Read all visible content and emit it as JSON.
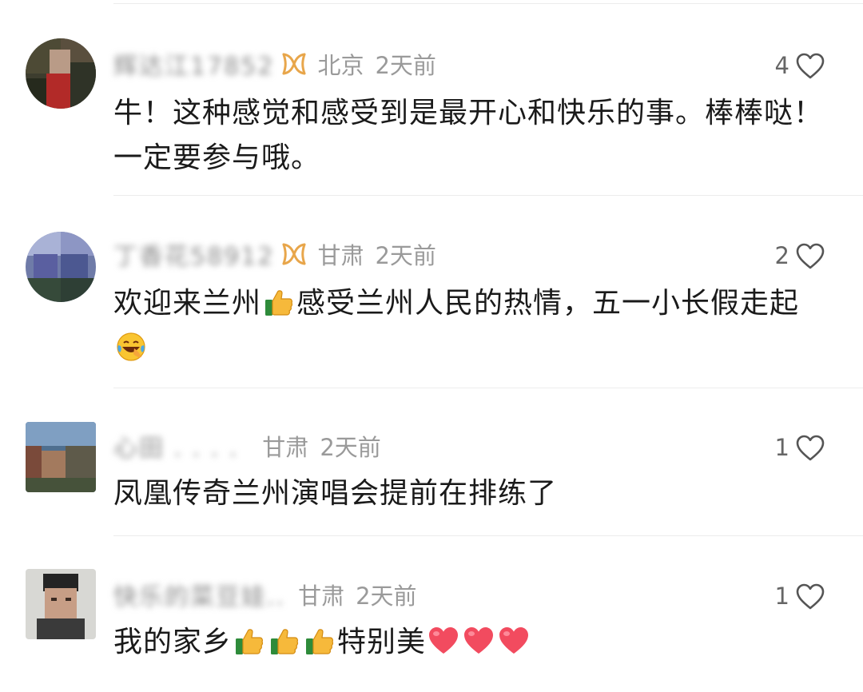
{
  "comments": [
    {
      "username": "辉达江17852",
      "has_vip_badge": true,
      "location": "北京",
      "time": "2天前",
      "likes": "4",
      "content": "牛！这种感觉和感受到是最开心和快乐的事。棒棒哒！一定要参与哦。"
    },
    {
      "username": "丁香花58912",
      "has_vip_badge": true,
      "location": "甘肃",
      "time": "2天前",
      "likes": "2",
      "content_parts": [
        "欢迎来兰州",
        "感受兰州人民的热情，五一小长假走起"
      ]
    },
    {
      "username": "心田 .  .  .  .",
      "has_vip_badge": false,
      "location": "甘肃",
      "time": "2天前",
      "likes": "1",
      "content": "凤凰传奇兰州演唱会提前在排练了"
    },
    {
      "username": "快乐的菜豆娃..",
      "has_vip_badge": false,
      "location": "甘肃",
      "time": "2天前",
      "likes": "1",
      "content_parts": [
        "我的家乡",
        "特别美"
      ]
    }
  ],
  "icons": {
    "like": "heart-outline-icon",
    "vip": "vip-badge-icon",
    "thumbs_up": "thumbs-up-emoji",
    "laugh_cry": "laughing-crying-emoji",
    "heart": "red-heart-emoji"
  },
  "colors": {
    "vip_badge": "#e8a64b",
    "meta_text": "#9a9a9a",
    "heart_emoji": "#f24b5f"
  }
}
